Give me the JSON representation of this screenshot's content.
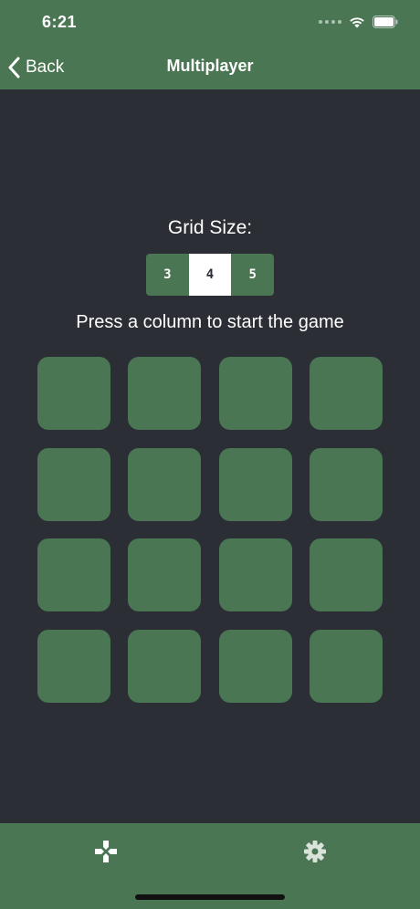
{
  "status_bar": {
    "time": "6:21"
  },
  "nav": {
    "back_label": "Back",
    "title": "Multiplayer"
  },
  "grid_size": {
    "label": "Grid Size:",
    "options": [
      "3",
      "4",
      "5"
    ],
    "selected": "4"
  },
  "instruction": "Press a column to start the game",
  "board": {
    "rows": 4,
    "columns": 4
  },
  "tabs": [
    {
      "icon": "gamepad-icon"
    },
    {
      "icon": "gear-icon"
    }
  ],
  "colors": {
    "accent": "#4a7653",
    "background": "#2b2e34",
    "text": "#ffffff"
  }
}
